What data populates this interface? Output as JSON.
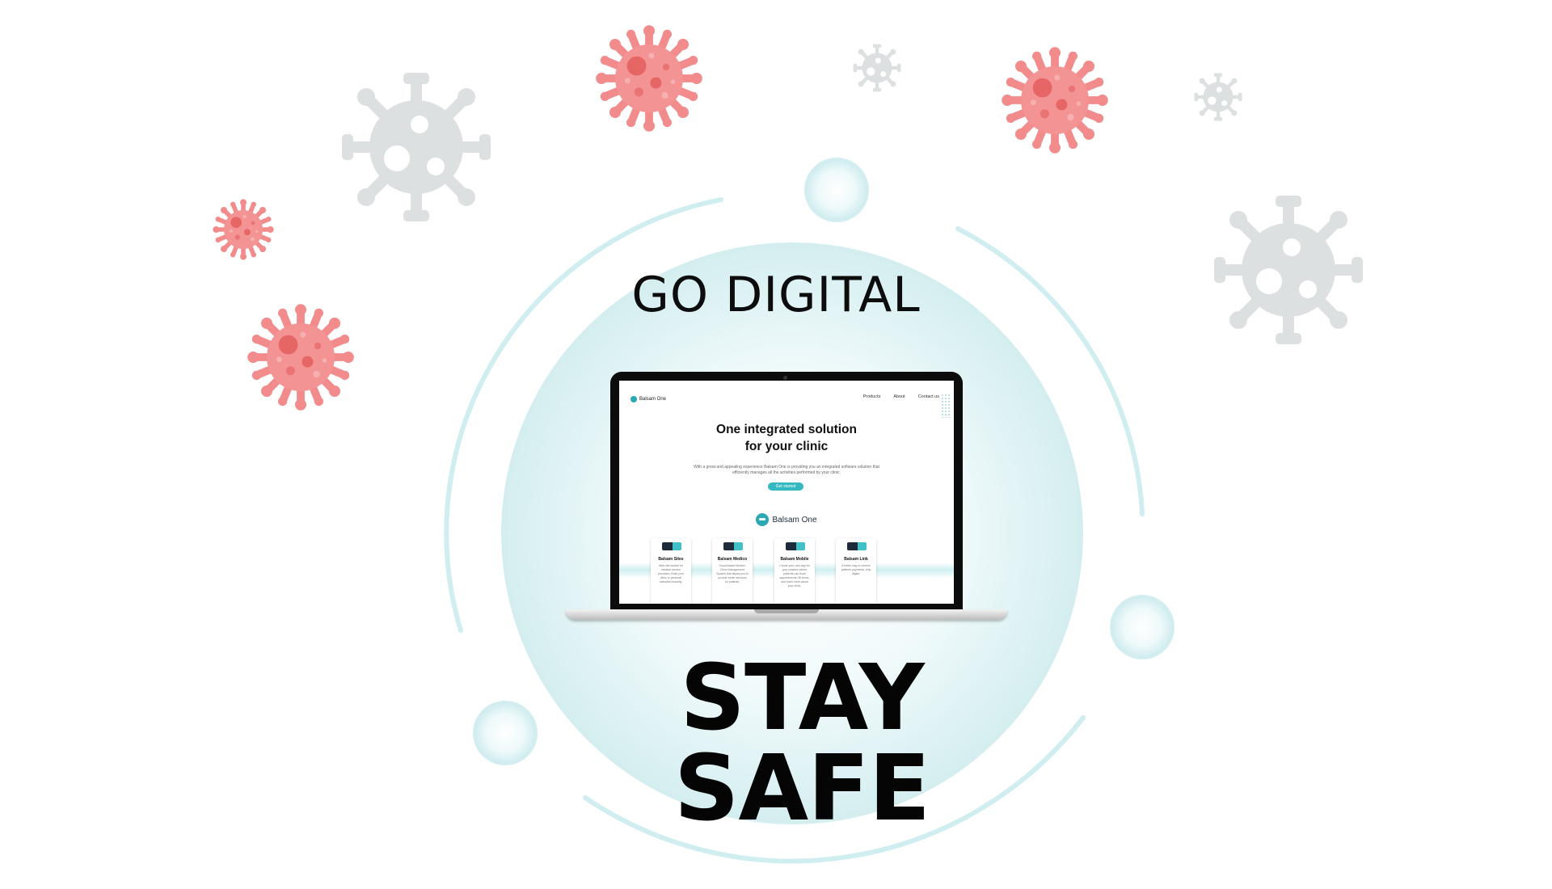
{
  "headline": "GO DIGITAL",
  "tagline": "STAY SAFE",
  "colors": {
    "virus_red": "#f28b8b",
    "virus_red_dark": "#e65c5c",
    "virus_gray": "#dcdede",
    "accent_teal": "#2aa8b3",
    "circle_fill": "#d8f0f1",
    "ring": "#cdebee"
  },
  "decorations": {
    "virus_icons": [
      "red-virus",
      "gray-virus"
    ]
  },
  "laptop_screen": {
    "logo_text": "Balsam One",
    "nav": [
      "Products",
      "About",
      "Contact us"
    ],
    "hero_title": "One integrated solution\nfor your clinic",
    "hero_text": "With a great and appealing experience Balsam One is providing you an integrated software solution that efficiently manages all the activities performed by your clinic.",
    "cta_label": "Get started",
    "brand_name": "Balsam One",
    "products": [
      {
        "title": "Balsam Sites",
        "desc": "Web site builder for medical service providers. Build your clinic or personal websites instantly."
      },
      {
        "title": "Balsam Medico",
        "desc": "Cloud-based Modern Clinic Management System that allows you to provide better services for patients."
      },
      {
        "title": "Balsam Mobile",
        "desc": "Create your own app for your practice where patients can book appointments, fill forms, and learn more about your clinic."
      },
      {
        "title": "Balsam Link",
        "desc": "A better way to receive patients payments, fully digital."
      }
    ]
  }
}
